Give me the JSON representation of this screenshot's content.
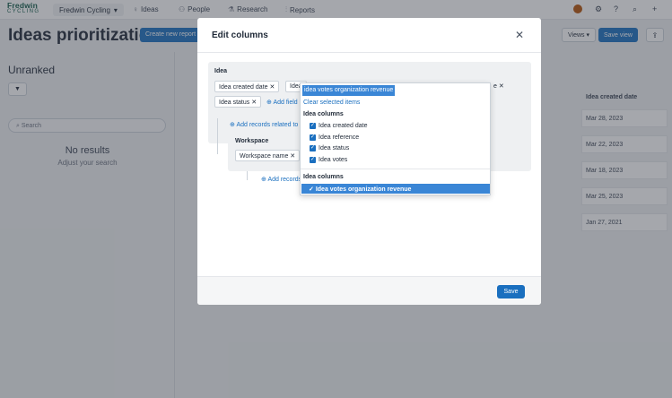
{
  "nav": {
    "logo_top": "Fredwin",
    "logo_bottom": "CYCLING",
    "workspace": "Fredwin Cycling",
    "items": [
      "Ideas",
      "People",
      "Research",
      "Reports"
    ]
  },
  "header": {
    "title": "Ideas prioritization",
    "create_label": "Create new report",
    "views_label": "Views",
    "save_view_label": "Save view"
  },
  "left": {
    "heading": "Unranked",
    "search_placeholder": "Search",
    "no_results": "No results",
    "adjust": "Adjust your search"
  },
  "table": {
    "header": "Idea created date",
    "dates": [
      "Mar 28, 2023",
      "Mar 22, 2023",
      "Mar 18, 2023",
      "Mar 25, 2023",
      "Jan 27, 2021"
    ]
  },
  "modal": {
    "title": "Edit columns",
    "idea_label": "Idea",
    "idea_chips": [
      "Idea created date",
      "Idea",
      "Idea status"
    ],
    "chip_partial": "e",
    "add_field": "Add field",
    "add_records_related": "Add records related to",
    "workspace_label": "Workspace",
    "workspace_chip": "Workspace name",
    "add_records": "Add records",
    "save_label": "Save"
  },
  "dropdown": {
    "input_value": "idea votes organization revenue",
    "clear": "Clear selected items",
    "group1": "Idea columns",
    "options": [
      "Idea created date",
      "Idea reference",
      "Idea status",
      "Idea votes"
    ],
    "group2": "Idea columns",
    "selected_option": "Idea votes organization revenue"
  },
  "colors": {
    "accent": "#1a6fbf",
    "highlight": "#3a86d6",
    "brand": "#0f5a47"
  }
}
